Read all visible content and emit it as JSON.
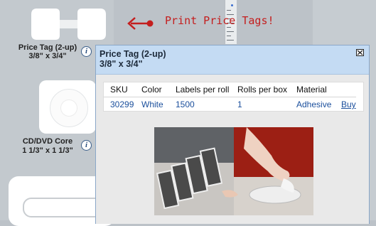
{
  "catalog": {
    "items": [
      {
        "name": "Price Tag (2-up)",
        "size": "3/8\" x 3/4\""
      },
      {
        "name": "CD/DVD Core",
        "size": "1 1/3\" x 1 1/3\""
      }
    ]
  },
  "promo": {
    "text": "Print Price Tags!",
    "arrow_icon": "left-arrow-icon",
    "color": "#c41e1e"
  },
  "popup": {
    "title_line1": "Price Tag (2-up)",
    "title_line2": "3/8\" x 3/4\"",
    "header_color": "#c4dbf3",
    "columns": [
      "SKU",
      "Color",
      "Labels per roll",
      "Rolls per box",
      "Material"
    ],
    "row": {
      "sku": "30299",
      "color": "White",
      "labels_per_roll": "1500",
      "rolls_per_box": "1",
      "material": "Adhesive",
      "action": "Buy"
    }
  }
}
